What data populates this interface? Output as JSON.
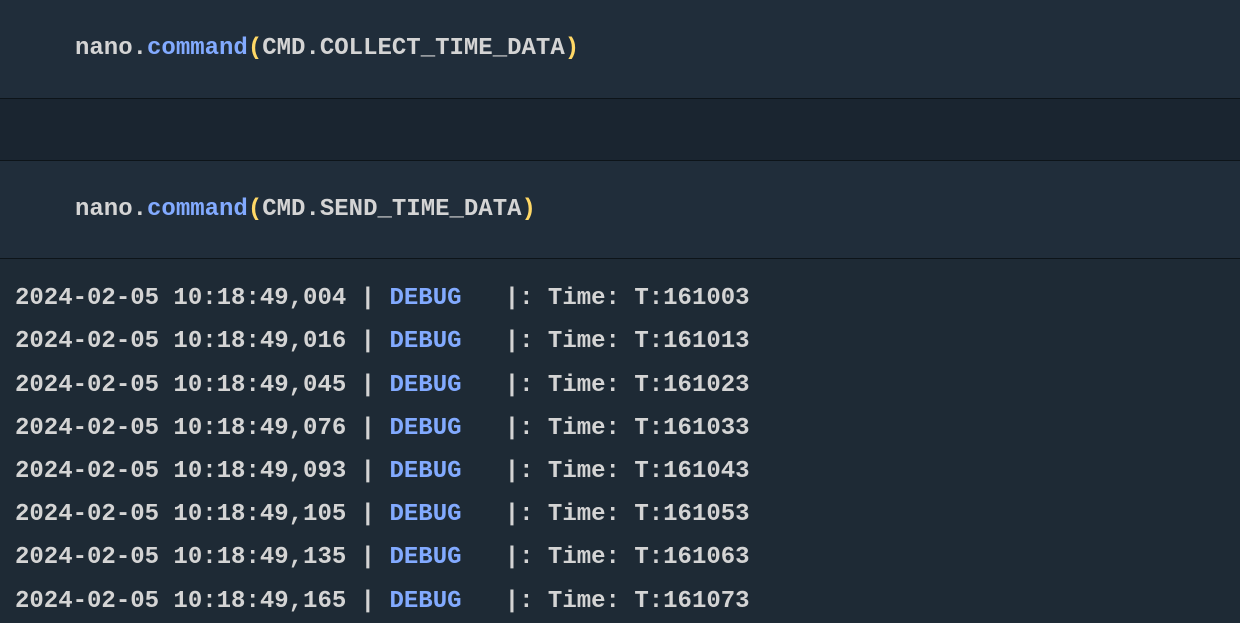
{
  "cells": [
    {
      "obj": "nano",
      "method": "command",
      "constClass": "CMD",
      "constName": "COLLECT_TIME_DATA"
    },
    {
      "obj": "nano",
      "method": "command",
      "constClass": "CMD",
      "constName": "SEND_TIME_DATA"
    }
  ],
  "logs": [
    {
      "ts": "2024-02-05 10:18:49,004",
      "level": "DEBUG",
      "msg": "Time: T:161003"
    },
    {
      "ts": "2024-02-05 10:18:49,016",
      "level": "DEBUG",
      "msg": "Time: T:161013"
    },
    {
      "ts": "2024-02-05 10:18:49,045",
      "level": "DEBUG",
      "msg": "Time: T:161023"
    },
    {
      "ts": "2024-02-05 10:18:49,076",
      "level": "DEBUG",
      "msg": "Time: T:161033"
    },
    {
      "ts": "2024-02-05 10:18:49,093",
      "level": "DEBUG",
      "msg": "Time: T:161043"
    },
    {
      "ts": "2024-02-05 10:18:49,105",
      "level": "DEBUG",
      "msg": "Time: T:161053"
    },
    {
      "ts": "2024-02-05 10:18:49,135",
      "level": "DEBUG",
      "msg": "Time: T:161063"
    },
    {
      "ts": "2024-02-05 10:18:49,165",
      "level": "DEBUG",
      "msg": "Time: T:161073"
    }
  ]
}
